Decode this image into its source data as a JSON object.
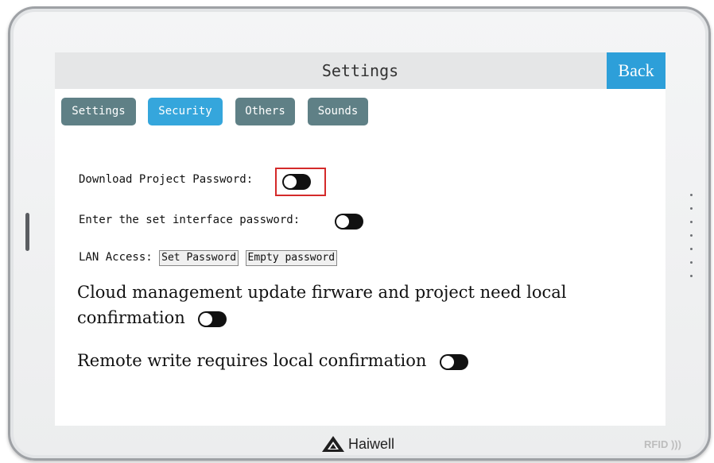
{
  "screen": {
    "title": "Settings",
    "back_label": "Back"
  },
  "tabs": [
    {
      "label": "Settings",
      "active": false
    },
    {
      "label": "Security",
      "active": true
    },
    {
      "label": "Others",
      "active": false
    },
    {
      "label": "Sounds",
      "active": false
    }
  ],
  "security": {
    "download_password_label": "Download Project Password:",
    "set_interface_password_label": "Enter the set interface password:",
    "lan_access_label": "LAN Access:",
    "set_password_button": "Set Password",
    "empty_password_button": "Empty password",
    "cloud_management_line1": "Cloud management update firware and project need local",
    "cloud_management_line2": "confirmation",
    "remote_write_label": "Remote write requires local confirmation"
  },
  "device": {
    "brand": "Haiwell",
    "rfid_label": "RFID"
  },
  "colors": {
    "accent_blue": "#2d9fd9",
    "tab_active": "#35a6dc",
    "tab_inactive": "#5f8086",
    "highlight_red": "#d42a2a"
  }
}
